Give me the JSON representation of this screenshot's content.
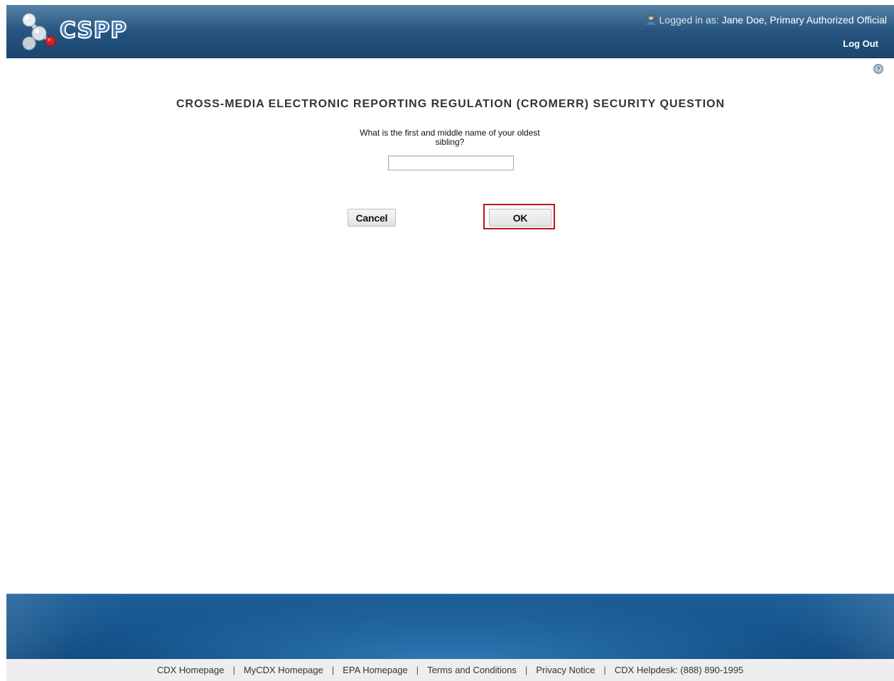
{
  "header": {
    "logo_text": "CSPP",
    "logged_in_label": "Logged in as:",
    "user_name": "Jane Doe, Primary Authorized Official",
    "logout_label": "Log Out",
    "help_icon": "help-icon"
  },
  "main": {
    "title": "CROSS-MEDIA ELECTRONIC REPORTING REGULATION (CROMERR) SECURITY QUESTION",
    "question_line1": "What is the first and middle name of your oldest",
    "question_line2": "sibling?",
    "answer_value": "",
    "cancel_label": "Cancel",
    "ok_label": "OK"
  },
  "footer": {
    "links": [
      "CDX Homepage",
      "MyCDX Homepage",
      "EPA Homepage",
      "Terms and Conditions",
      "Privacy Notice",
      "CDX Helpdesk: (888) 890-1995"
    ],
    "separator": "|"
  },
  "colors": {
    "header_blue": "#27557f",
    "highlight_red": "#c0131d",
    "footer_blue": "#15548c"
  }
}
